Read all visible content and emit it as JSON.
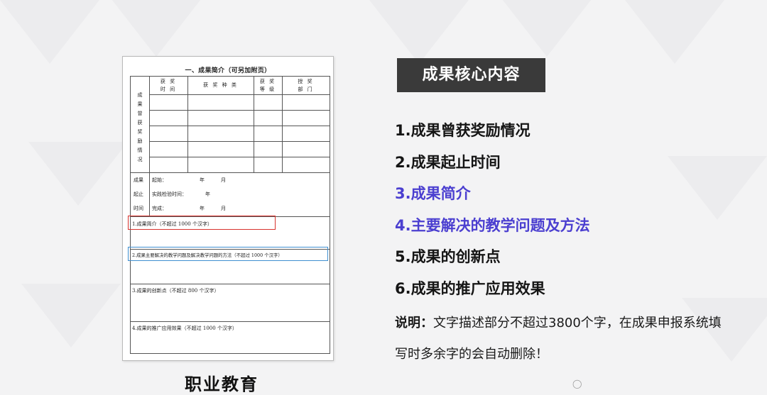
{
  "document": {
    "title": "一、成果简介（可另加附页）",
    "table_headers": [
      "获 奖\n时 间",
      "获 奖 种 类",
      "获 奖\n等 级",
      "授 奖\n部 门"
    ],
    "award_label": "成\n果\n曾\n获\n奖\n励\n情\n况",
    "period_labels": [
      "成果",
      "起止",
      "时间"
    ],
    "period_rows": [
      "起始：",
      "实践检验时间：",
      "完成："
    ],
    "period_units": [
      "年",
      "月",
      "年",
      "年",
      "月"
    ],
    "sections": [
      "1.成果简介（不超过 1000 个汉字）",
      "2.成果主要解决的教学问题及解决教学问题的方法（不超过 1000 个汉字）",
      "3.成果的创新点（不超过 800 个汉字）",
      "4.成果的推广应用效果（不超过 1000 个汉字）"
    ],
    "caption": "职业教育"
  },
  "panel": {
    "badge": "成果核心内容",
    "items": [
      {
        "text": "1.成果曾获奖励情况",
        "accent": false
      },
      {
        "text": "2.成果起止时间",
        "accent": false
      },
      {
        "text": "3.成果简介",
        "accent": true
      },
      {
        "text": "4.主要解决的教学问题及方法",
        "accent": true
      },
      {
        "text": "5.成果的创新点",
        "accent": false
      },
      {
        "text": "6.成果的推广应用效果",
        "accent": false
      }
    ],
    "note_label": "说明：",
    "note_text": "文字描述部分不超过3800个字，在成果申报系统填写时多余字的会自动删除！"
  },
  "colors": {
    "accent": "#4b3fd0",
    "badge_bg": "#3a3a3a",
    "red_box": "#d8332e",
    "blue_box": "#3f8fd0"
  }
}
